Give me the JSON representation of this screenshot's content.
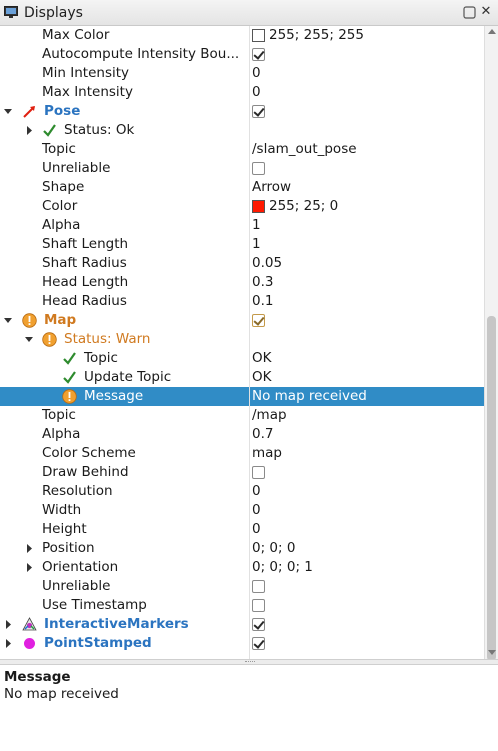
{
  "panel": {
    "title": "Displays",
    "close_glyph": "✕"
  },
  "rows": [
    {
      "name": "Max Color",
      "value": "255; 255; 255",
      "swatch": "#ffffff"
    },
    {
      "name": "Autocompute Intensity Bou...",
      "checkbox": true
    },
    {
      "name": "Min Intensity",
      "value": "0"
    },
    {
      "name": "Max Intensity",
      "value": "0"
    },
    {
      "name": "Pose",
      "checkbox": true,
      "icon": "pose-arrow-icon"
    },
    {
      "name": "Status: Ok",
      "icon": "check-icon"
    },
    {
      "name": "Topic",
      "value": "/slam_out_pose"
    },
    {
      "name": "Unreliable",
      "checkbox": false
    },
    {
      "name": "Shape",
      "value": "Arrow"
    },
    {
      "name": "Color",
      "value": "255; 25; 0",
      "swatch": "#ff1900"
    },
    {
      "name": "Alpha",
      "value": "1"
    },
    {
      "name": "Shaft Length",
      "value": "1"
    },
    {
      "name": "Shaft Radius",
      "value": "0.05"
    },
    {
      "name": "Head Length",
      "value": "0.3"
    },
    {
      "name": "Head Radius",
      "value": "0.1"
    },
    {
      "name": "Map",
      "checkbox": true,
      "icon": "warning-icon"
    },
    {
      "name": "Status: Warn",
      "icon": "warning-icon"
    },
    {
      "name": "Topic",
      "value": "OK",
      "icon": "check-icon"
    },
    {
      "name": "Update Topic",
      "value": "OK",
      "icon": "check-icon"
    },
    {
      "name": "Message",
      "value": "No map received",
      "icon": "warning-icon"
    },
    {
      "name": "Topic",
      "value": "/map"
    },
    {
      "name": "Alpha",
      "value": "0.7"
    },
    {
      "name": "Color Scheme",
      "value": "map"
    },
    {
      "name": "Draw Behind",
      "checkbox": false
    },
    {
      "name": "Resolution",
      "value": "0"
    },
    {
      "name": "Width",
      "value": "0"
    },
    {
      "name": "Height",
      "value": "0"
    },
    {
      "name": "Position",
      "value": "0; 0; 0"
    },
    {
      "name": "Orientation",
      "value": "0; 0; 0; 1"
    },
    {
      "name": "Unreliable",
      "checkbox": false
    },
    {
      "name": "Use Timestamp",
      "checkbox": false
    },
    {
      "name": "InteractiveMarkers",
      "checkbox": true,
      "icon": "interactive-markers-icon"
    },
    {
      "name": "PointStamped",
      "checkbox": true,
      "icon": "point-stamped-icon"
    }
  ],
  "description": {
    "title": "Message",
    "text": "No map received"
  },
  "colors": {
    "selection": "#308cc6",
    "display_name_blue": "#2b74c0",
    "warn_orange": "#d07a20",
    "check_green": "#2e8b2e"
  }
}
